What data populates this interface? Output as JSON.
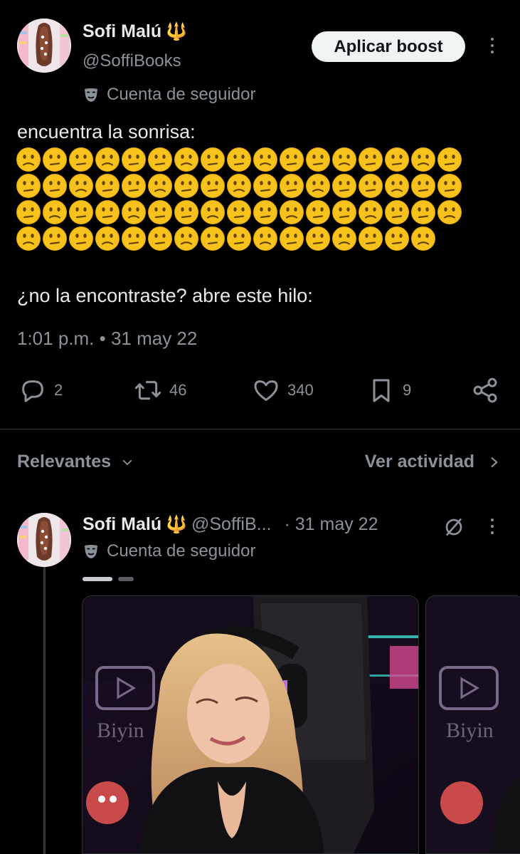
{
  "post": {
    "author_name": "Sofi Malú",
    "author_emoji": "🔱",
    "handle": "@SoffiBooks",
    "boost_label": "Aplicar boost",
    "account_label": "Cuenta de seguidor",
    "text_line1": "encuentra la sonrisa:",
    "emoji_rows": [
      17,
      17,
      17,
      16
    ],
    "text_line2": "¿no la encontraste? abre este hilo:",
    "timestamp": "1:01 p.m. • 31 may 22",
    "stats": {
      "replies": "2",
      "reposts": "46",
      "likes": "340",
      "bookmarks": "9"
    }
  },
  "replies_header": {
    "sort_label": "Relevantes",
    "activity_label": "Ver actividad"
  },
  "reply": {
    "author_name": "Sofi Malú",
    "author_emoji": "🔱",
    "handle": "@SoffiB...",
    "date": "· 31 may 22",
    "account_label": "Cuenta de seguidor",
    "carousel": {
      "count": 2,
      "active": 0
    },
    "media_text": "Biyin"
  },
  "colors": {
    "background": "#000000",
    "primary_text": "#e7e9ea",
    "secondary_text": "#8b9198",
    "divider": "#2f3336",
    "emoji_yellow": "#f7c21c",
    "trident": "#e8a317"
  },
  "icons": {
    "reply": "speech-bubble-icon",
    "repost": "repost-arrows-icon",
    "like": "heart-icon",
    "bookmark": "bookmark-icon",
    "share": "share-icon",
    "more": "kebab-menu-icon",
    "follower": "theater-mask-icon",
    "grok": "slashed-circle-icon"
  }
}
